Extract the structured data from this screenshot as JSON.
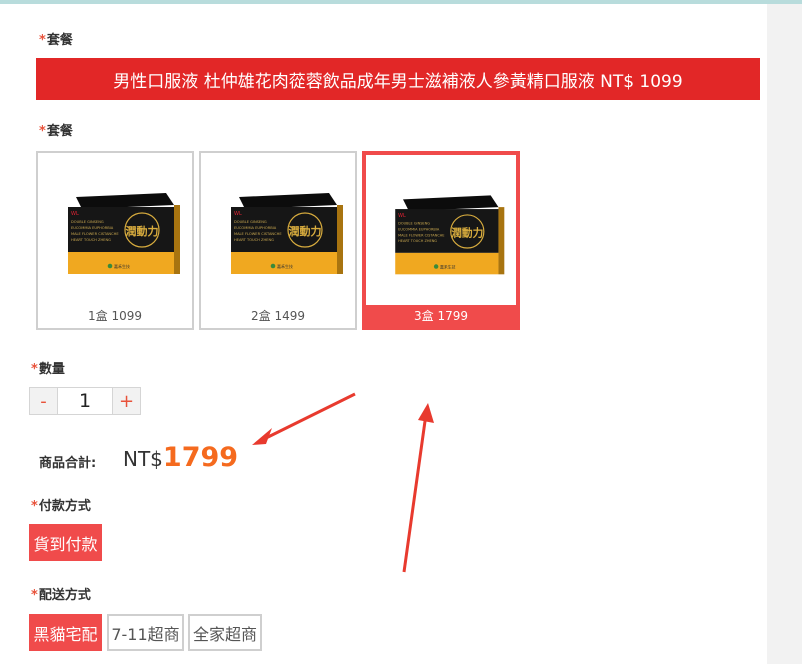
{
  "package_section": {
    "label": "套餐",
    "selected_title": "男性口服液 杜仲雄花肉蓯蓉飲品成年男士滋補液人參黃精口服液 NT$ 1099"
  },
  "options_section": {
    "label": "套餐",
    "items": [
      {
        "caption": "1盒 1099",
        "selected": false
      },
      {
        "caption": "2盒 1499",
        "selected": false
      },
      {
        "caption": "3盒 1799",
        "selected": true
      }
    ],
    "product_box": {
      "brand_mark": "WL",
      "lines": [
        "DOUBLE GINSENG",
        "EUCOMMIA EUPHORBIA",
        "MALE FLOWER CISTANCHE",
        "HEART TOUCH ZHENG"
      ],
      "emblem": "潤動力",
      "footer_brand": "嘉禾生技",
      "colors": {
        "top": "#161616",
        "bottom": "#f0a820",
        "gold": "#d8ac3e"
      }
    }
  },
  "quantity_section": {
    "label": "數量",
    "minus": "-",
    "value": "1",
    "plus": "+"
  },
  "total_section": {
    "label": "商品合計:",
    "currency": "NT$",
    "amount": "1799"
  },
  "payment_section": {
    "label": "付款方式",
    "options": [
      {
        "label": "貨到付款",
        "selected": true
      }
    ]
  },
  "shipping_section": {
    "label": "配送方式",
    "options": [
      {
        "label": "黑貓宅配",
        "selected": true
      },
      {
        "label": "7-11超商",
        "selected": false
      },
      {
        "label": "全家超商",
        "selected": false
      }
    ]
  },
  "required_mark": "*",
  "colors": {
    "accent": "#e22727",
    "selected": "#f04b4b",
    "price": "#f56a1e",
    "arrow": "#e83a2e"
  }
}
